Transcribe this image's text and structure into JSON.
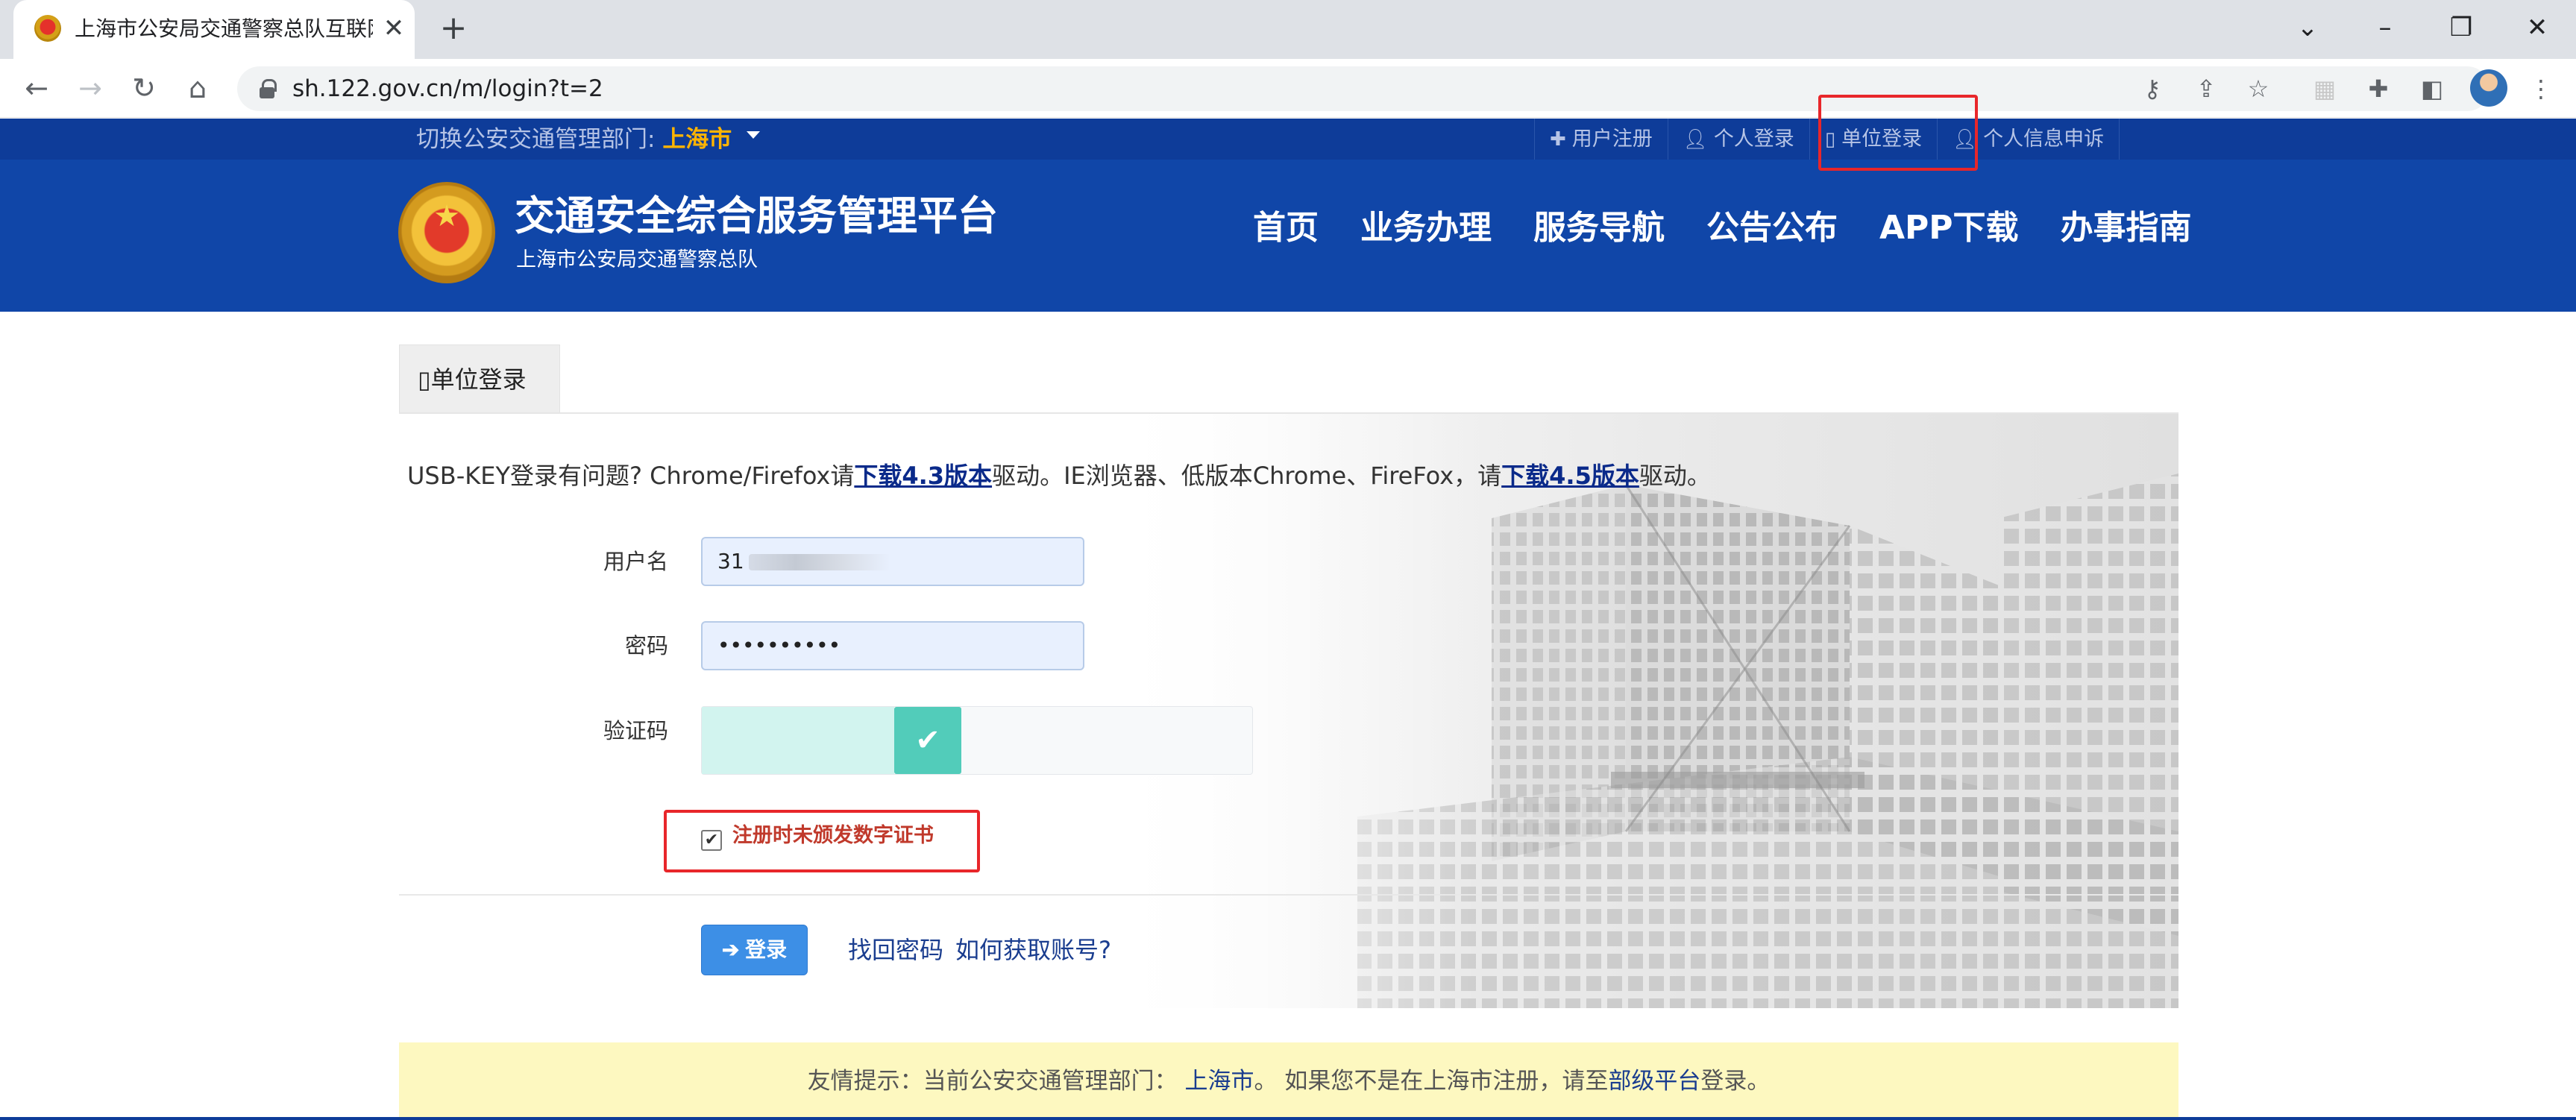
{
  "browser": {
    "tab_title": "上海市公安局交通警察总队互联网",
    "url": "sh.122.gov.cn/m/login?t=2"
  },
  "topbar": {
    "switch_label": "切换公安交通管理部门:",
    "city": "上海市",
    "links": [
      {
        "icon": "plus-icon",
        "label": "用户注册"
      },
      {
        "icon": "user-icon",
        "label": "个人登录"
      },
      {
        "icon": "building-icon",
        "label": "单位登录"
      },
      {
        "icon": "user-icon",
        "label": "个人信息申诉"
      }
    ]
  },
  "header": {
    "title": "交通安全综合服务管理平台",
    "subtitle": "上海市公安局交通警察总队",
    "nav": [
      "首页",
      "业务办理",
      "服务导航",
      "公告公布",
      "APP下载",
      "办事指南"
    ]
  },
  "login": {
    "tab_label": "单位登录",
    "usb_tip": {
      "prefix": "USB-KEY登录有问题? Chrome/Firefox请",
      "link1": "下载4.3版本",
      "middle": "驱动。IE浏览器、低版本Chrome、FireFox，请",
      "link2": "下载4.5版本",
      "suffix": "驱动。"
    },
    "username_label": "用户名",
    "username_value": "31",
    "password_label": "密码",
    "password_value": "••••••••••",
    "captcha_label": "验证码",
    "captcha_progress": 0.35,
    "cert_checkbox_label": "注册时未颁发数字证书",
    "cert_checked": true,
    "login_button": "登录",
    "forgot_link": "找回密码",
    "get_account_link": "如何获取账号?"
  },
  "notice": {
    "part1": "友情提示：当前公安交通管理部门：",
    "city": "上海市",
    "part2": "。 如果您不是在上海市注册，请至",
    "link": "部级平台",
    "part3": "登录。"
  },
  "colors": {
    "header_blue": "#1046a8",
    "strip_blue": "#0e3c99",
    "accent_orange": "#ffb400",
    "annotation_red": "#e8262a"
  }
}
